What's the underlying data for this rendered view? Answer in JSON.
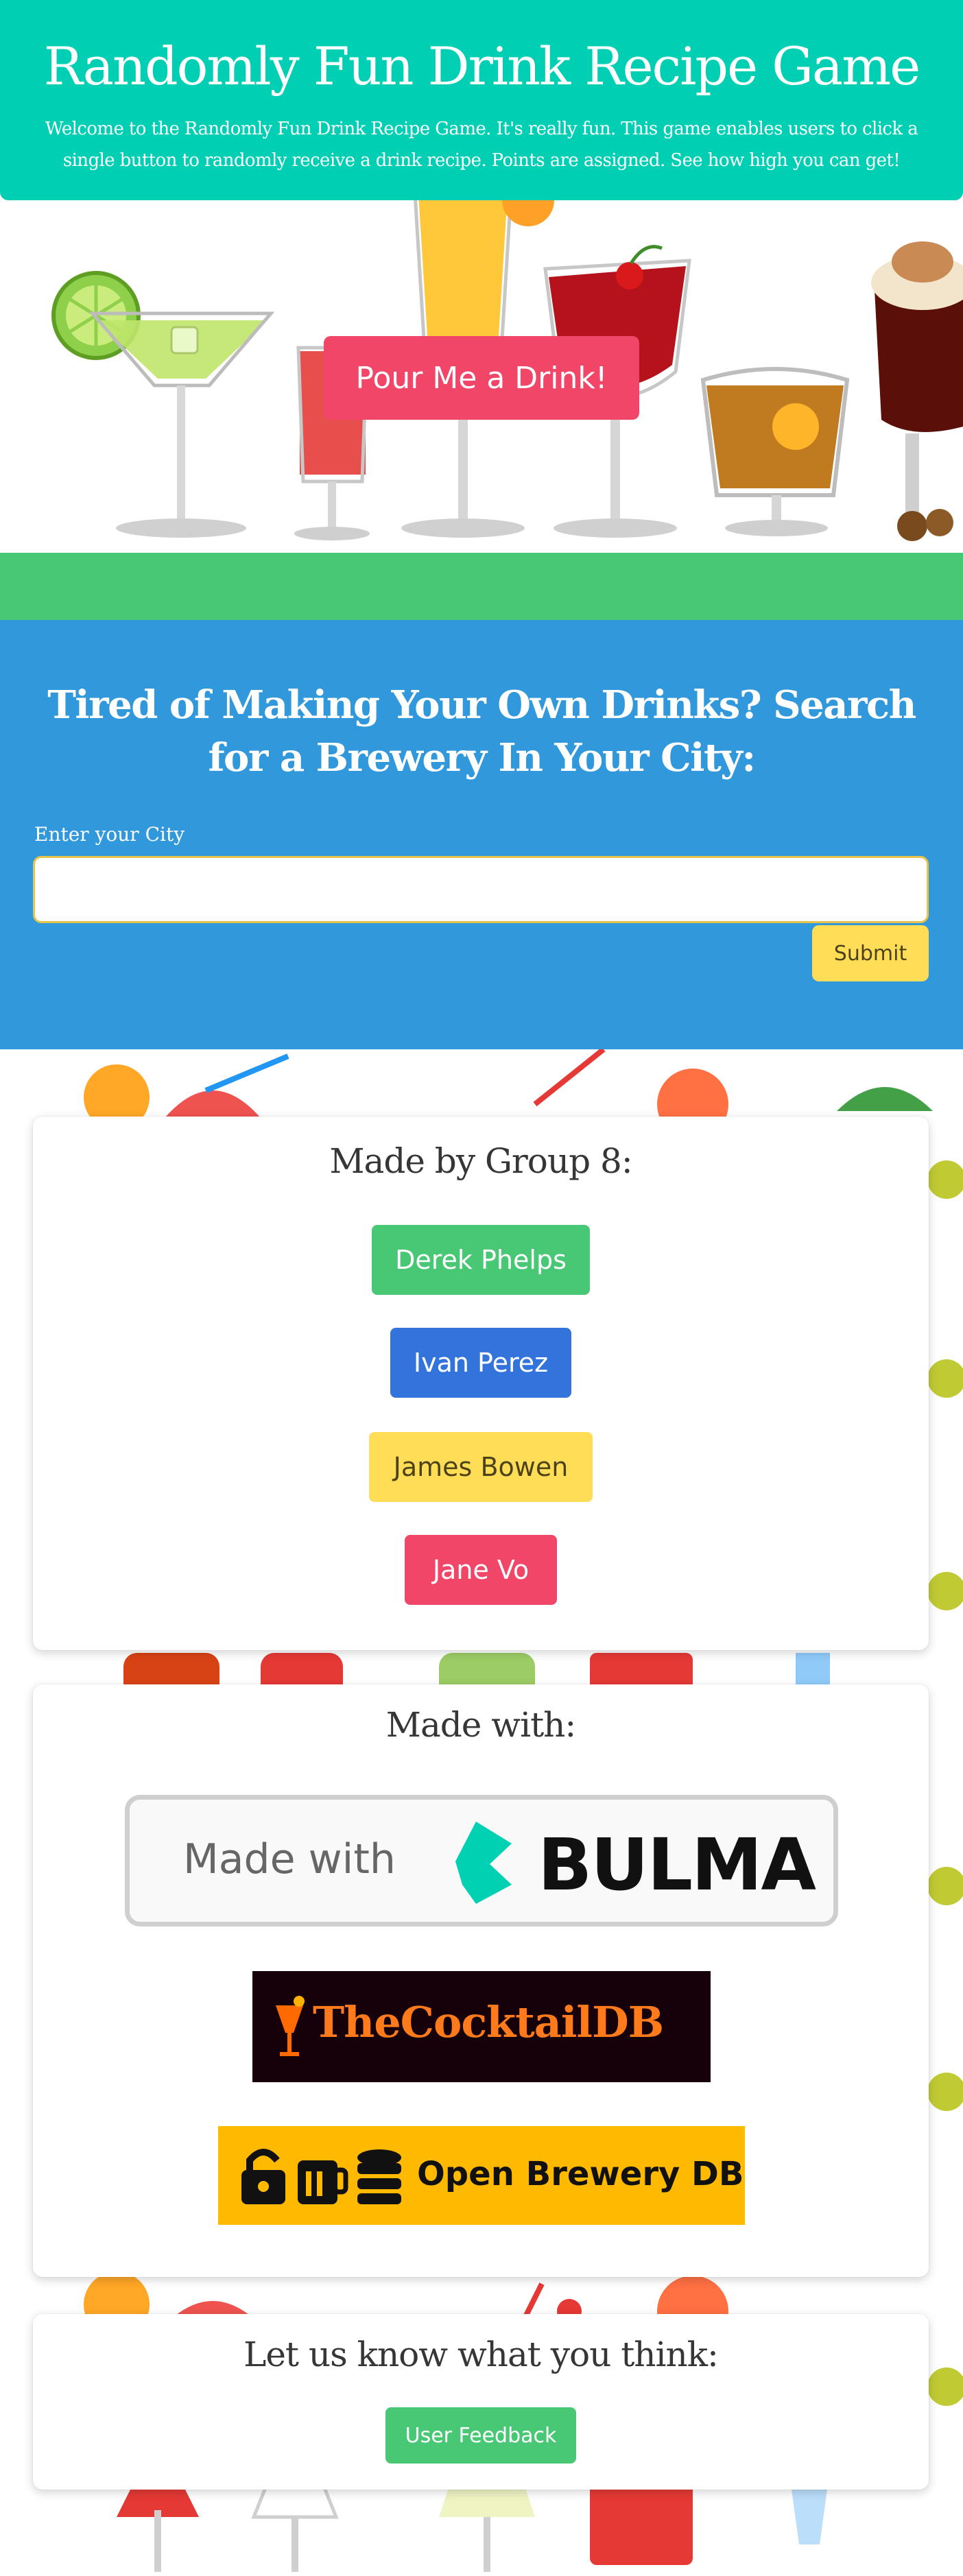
{
  "header": {
    "title": "Randomly Fun Drink Recipe Game",
    "subtitle": "Welcome to the Randomly Fun Drink Recipe Game. It's really fun. This game enables users to click a single button to randomly receive a drink recipe. Points are assigned. See how high you can get!"
  },
  "drink_section": {
    "pour_button_label": "Pour Me a Drink!"
  },
  "brewery": {
    "title": "Tired of Making Your Own Drinks? Search for a Brewery In Your City:",
    "city_label": "Enter your City",
    "city_value": "",
    "submit_label": "Submit"
  },
  "team": {
    "title": "Made by Group 8:",
    "members": [
      {
        "name": "Derek Phelps",
        "color": "#48c774"
      },
      {
        "name": "Ivan Perez",
        "color": "#3273dc"
      },
      {
        "name": "James Bowen",
        "color": "#ffdd57"
      },
      {
        "name": "Jane Vo",
        "color": "#f14668"
      }
    ]
  },
  "made_with": {
    "title": "Made with:",
    "logos": {
      "bulma": {
        "prefix": "Made with",
        "name": "BULMA",
        "accent": "#00d1b2"
      },
      "cocktaildb": {
        "name": "TheCocktailDB",
        "accent": "#ff7a1a"
      },
      "openbrewerydb": {
        "name": "Open Brewery DB",
        "accent": "#ffba00"
      }
    }
  },
  "feedback": {
    "title": "Let us know what you think:",
    "button_label": "User Feedback"
  },
  "colors": {
    "header_bg": "#00cfb4",
    "green_bar": "#48c774",
    "brewery_bg": "#3298dc",
    "primary_red": "#f14668",
    "warning_yellow": "#ffdd57"
  }
}
